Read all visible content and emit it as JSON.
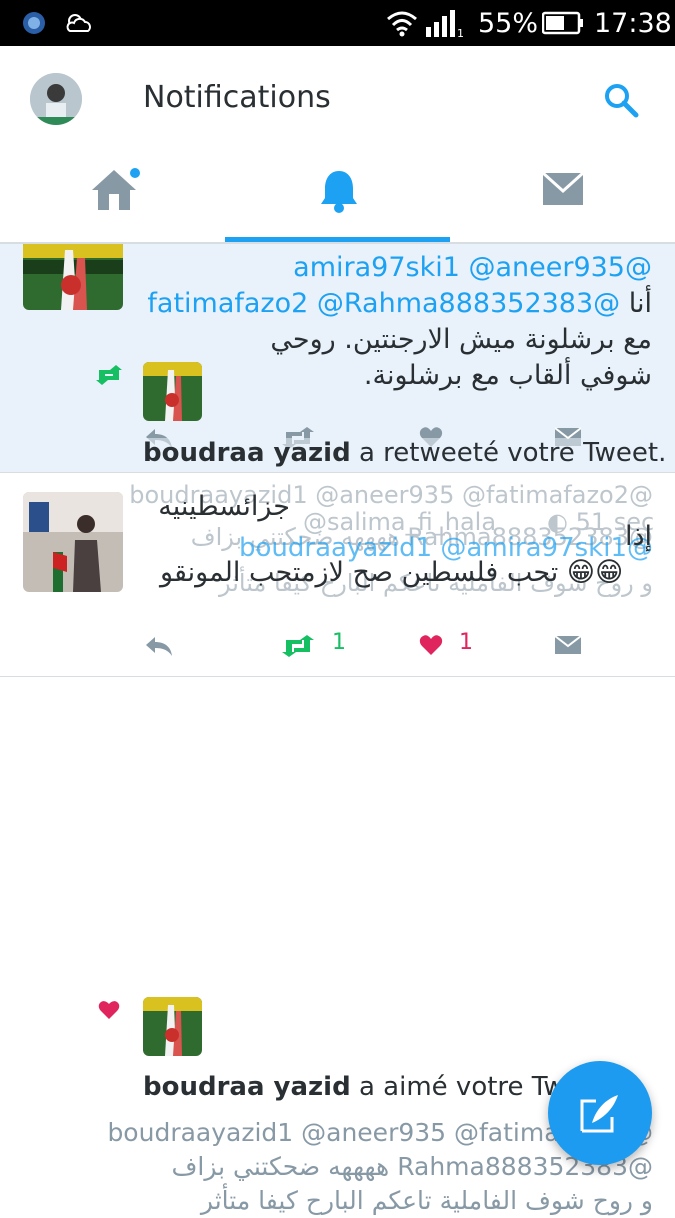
{
  "status_bar": {
    "battery": "55%",
    "time": "17:38"
  },
  "header": {
    "title": "Notifications"
  },
  "tabs": [
    {
      "name": "home",
      "icon": "home-icon",
      "has_dot": true
    },
    {
      "name": "notifications",
      "icon": "bell-icon",
      "active": true
    },
    {
      "name": "messages",
      "icon": "envelope-icon"
    }
  ],
  "notification_1": {
    "mentions_line1": "@amira97ski1 @aneer935",
    "mentions_line2": "@fatimafazo2 @Rahma888352383",
    "prefix_word": "أنا",
    "text_line2": "مع برشلونة ميش الارجنتين. روحي",
    "text_line3": "شوفي ألقاب مع برشلونة.",
    "actor_name": "boudraa yazid",
    "action": "a retweeté votre Tweet."
  },
  "notification_2": {
    "ghost_mentions": "@boudraayazid1 @aneer935 @fatimafazo2",
    "ghost_handle": "@salima_fi_hala",
    "ghost_time": "51 sec",
    "ghost_line2": "@Rahma888352383 ههههه ضحكتني بزاف",
    "ghost_mentions2": "@boudraayazid1 @amira97ski1",
    "ghost_line3": "و روح شوف الفاملية تاعكم البارح كيفا متأثر",
    "text_line1": "جزائسطينيه",
    "text_line2": "إذا",
    "text_line3": "تحب فلسطين صح لازمتحب المونقو",
    "emoji": "😁😁",
    "retweet_count": "1",
    "like_count": "1"
  },
  "notification_3": {
    "actor_name": "boudraa yazid",
    "action": "a aimé votre Tweet.",
    "mentions": "@boudraayazid1 @aneer935 @fatimafazo2",
    "line2": "@Rahma888352383 ههههه ضحكتني بزاف",
    "line3": "و روح شوف الفاملية تاعكم البارح كيفا متأثر"
  },
  "colors": {
    "accent": "#1da1f2",
    "retweet": "#17bf63",
    "like": "#e0245e",
    "icon_grey": "#8899a6",
    "highlight_bg": "#e9f2fa"
  }
}
